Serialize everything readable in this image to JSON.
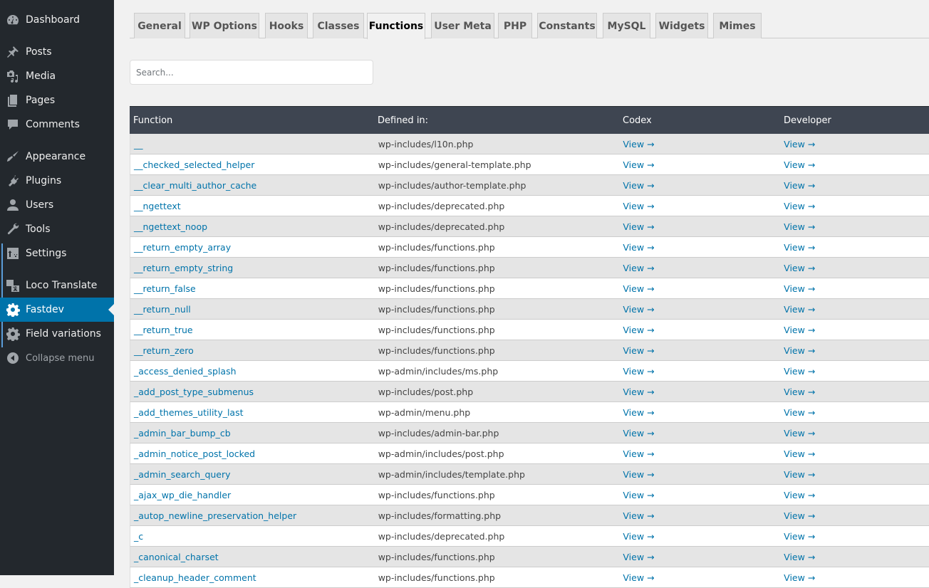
{
  "sidebar": {
    "items": [
      {
        "label": "Dashboard",
        "icon": "dashboard-icon"
      },
      {
        "label": "Posts",
        "icon": "pin-icon"
      },
      {
        "label": "Media",
        "icon": "media-icon"
      },
      {
        "label": "Pages",
        "icon": "pages-icon"
      },
      {
        "label": "Comments",
        "icon": "comment-icon"
      },
      {
        "label": "Appearance",
        "icon": "paintbrush-icon"
      },
      {
        "label": "Plugins",
        "icon": "plugin-icon"
      },
      {
        "label": "Users",
        "icon": "user-icon"
      },
      {
        "label": "Tools",
        "icon": "wrench-icon"
      },
      {
        "label": "Settings",
        "icon": "settings-icon"
      },
      {
        "label": "Loco Translate",
        "icon": "translate-icon"
      },
      {
        "label": "Fastdev",
        "icon": "gear-icon",
        "active": true
      },
      {
        "label": "Field variations",
        "icon": "gear-icon"
      }
    ],
    "collapse_label": "Collapse menu",
    "accent_color": "#0073aa"
  },
  "tabs": [
    {
      "label": "General"
    },
    {
      "label": "WP Options"
    },
    {
      "label": "Hooks"
    },
    {
      "label": "Classes"
    },
    {
      "label": "Functions",
      "active": true
    },
    {
      "label": "User Meta"
    },
    {
      "label": "PHP"
    },
    {
      "label": "Constants"
    },
    {
      "label": "MySQL"
    },
    {
      "label": "Widgets"
    },
    {
      "label": "Mimes"
    }
  ],
  "search": {
    "placeholder": "Search...",
    "value": ""
  },
  "table": {
    "headers": [
      "Function",
      "Defined in:",
      "Codex",
      "Developer"
    ],
    "link_label": "View →",
    "rows": [
      {
        "fn": "__",
        "file": "wp-includes/l10n.php"
      },
      {
        "fn": "__checked_selected_helper",
        "file": "wp-includes/general-template.php"
      },
      {
        "fn": "__clear_multi_author_cache",
        "file": "wp-includes/author-template.php"
      },
      {
        "fn": "__ngettext",
        "file": "wp-includes/deprecated.php"
      },
      {
        "fn": "__ngettext_noop",
        "file": "wp-includes/deprecated.php"
      },
      {
        "fn": "__return_empty_array",
        "file": "wp-includes/functions.php"
      },
      {
        "fn": "__return_empty_string",
        "file": "wp-includes/functions.php"
      },
      {
        "fn": "__return_false",
        "file": "wp-includes/functions.php"
      },
      {
        "fn": "__return_null",
        "file": "wp-includes/functions.php"
      },
      {
        "fn": "__return_true",
        "file": "wp-includes/functions.php"
      },
      {
        "fn": "__return_zero",
        "file": "wp-includes/functions.php"
      },
      {
        "fn": "_access_denied_splash",
        "file": "wp-admin/includes/ms.php"
      },
      {
        "fn": "_add_post_type_submenus",
        "file": "wp-includes/post.php"
      },
      {
        "fn": "_add_themes_utility_last",
        "file": "wp-admin/menu.php"
      },
      {
        "fn": "_admin_bar_bump_cb",
        "file": "wp-includes/admin-bar.php"
      },
      {
        "fn": "_admin_notice_post_locked",
        "file": "wp-admin/includes/post.php"
      },
      {
        "fn": "_admin_search_query",
        "file": "wp-admin/includes/template.php"
      },
      {
        "fn": "_ajax_wp_die_handler",
        "file": "wp-includes/functions.php"
      },
      {
        "fn": "_autop_newline_preservation_helper",
        "file": "wp-includes/formatting.php"
      },
      {
        "fn": "_c",
        "file": "wp-includes/deprecated.php"
      },
      {
        "fn": "_canonical_charset",
        "file": "wp-includes/functions.php"
      },
      {
        "fn": "_cleanup_header_comment",
        "file": "wp-includes/functions.php"
      }
    ]
  }
}
